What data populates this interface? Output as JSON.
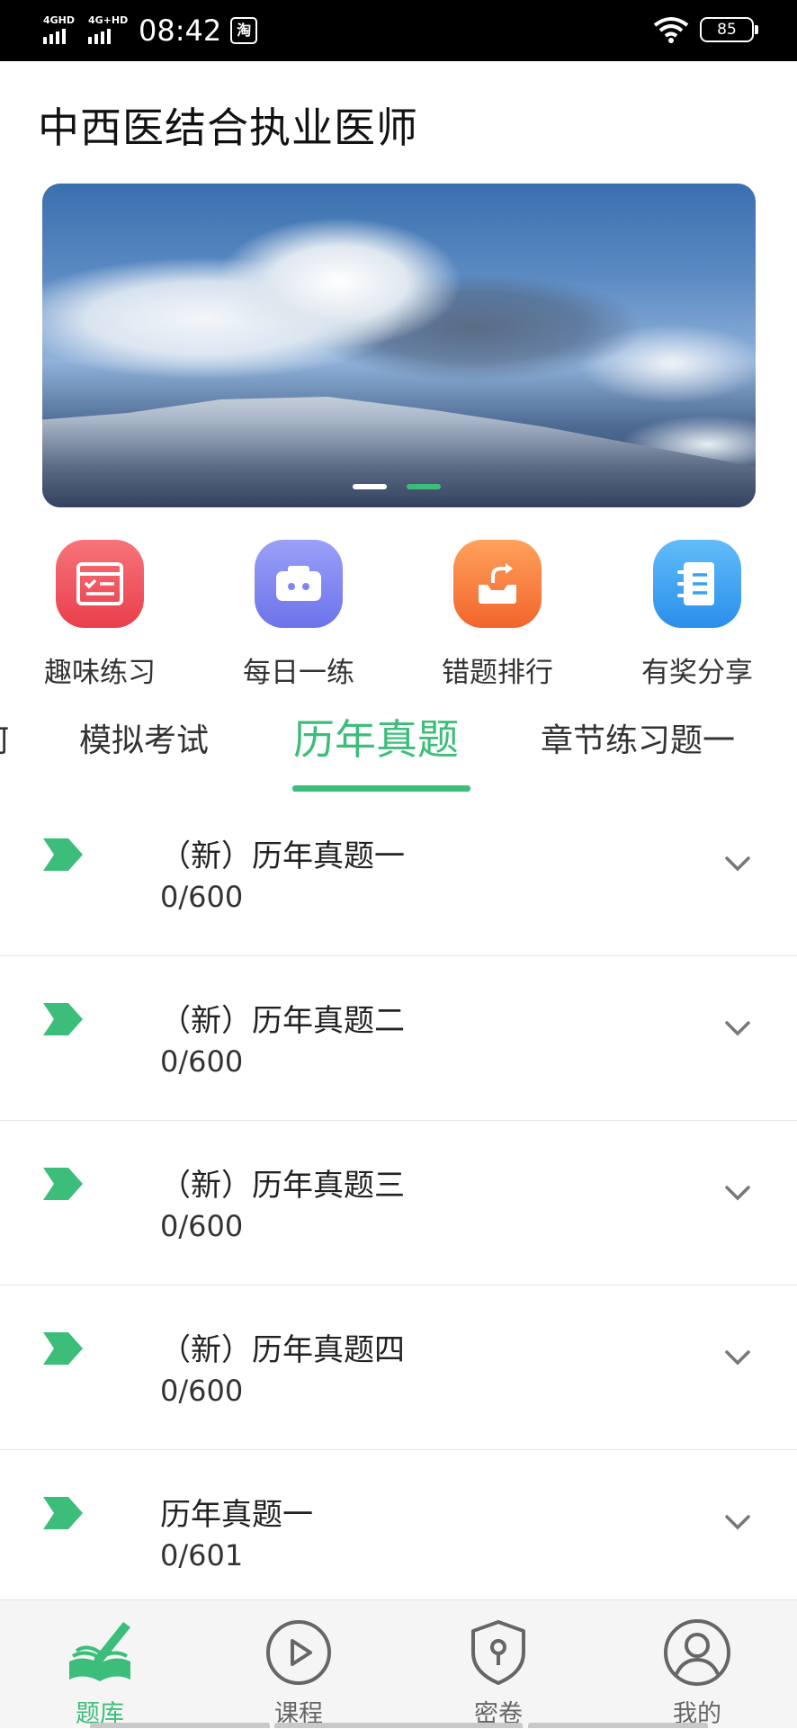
{
  "status_bar": {
    "net1": "4GHD",
    "net2": "4G+HD",
    "time": "08:42",
    "app_badge": "淘",
    "battery": "85"
  },
  "header": {
    "title": "中西医结合执业医师"
  },
  "banner": {
    "active_index": 1,
    "dot_count": 2,
    "colors": {
      "dot_active": "#3cbe7a",
      "dot_inactive": "#ffffff"
    }
  },
  "quick_nav": [
    {
      "label": "趣味练习",
      "icon": "quiz-checklist-icon",
      "color": "#f0545a"
    },
    {
      "label": "每日一练",
      "icon": "calendar-box-icon",
      "color": "#7f86f2"
    },
    {
      "label": "错题排行",
      "icon": "share-box-icon",
      "color": "#f77a3a"
    },
    {
      "label": "有奖分享",
      "icon": "notebook-icon",
      "color": "#3aa1f2"
    }
  ],
  "tabs": {
    "partial_left": "何",
    "items": [
      "模拟考试",
      "历年真题",
      "章节练习题一"
    ],
    "active": "历年真题"
  },
  "list": [
    {
      "title": "（新）历年真题一",
      "progress": "0/600"
    },
    {
      "title": "（新）历年真题二",
      "progress": "0/600"
    },
    {
      "title": "（新）历年真题三",
      "progress": "0/600"
    },
    {
      "title": "（新）历年真题四",
      "progress": "0/600"
    },
    {
      "title": "历年真题一",
      "progress": "0/601"
    }
  ],
  "bottom_nav": [
    {
      "label": "题库",
      "icon": "book-pen-icon",
      "active": true
    },
    {
      "label": "课程",
      "icon": "play-circle-icon",
      "active": false
    },
    {
      "label": "密卷",
      "icon": "shield-lock-icon",
      "active": false
    },
    {
      "label": "我的",
      "icon": "user-circle-icon",
      "active": false
    }
  ],
  "colors": {
    "accent": "#3cbe7a"
  }
}
